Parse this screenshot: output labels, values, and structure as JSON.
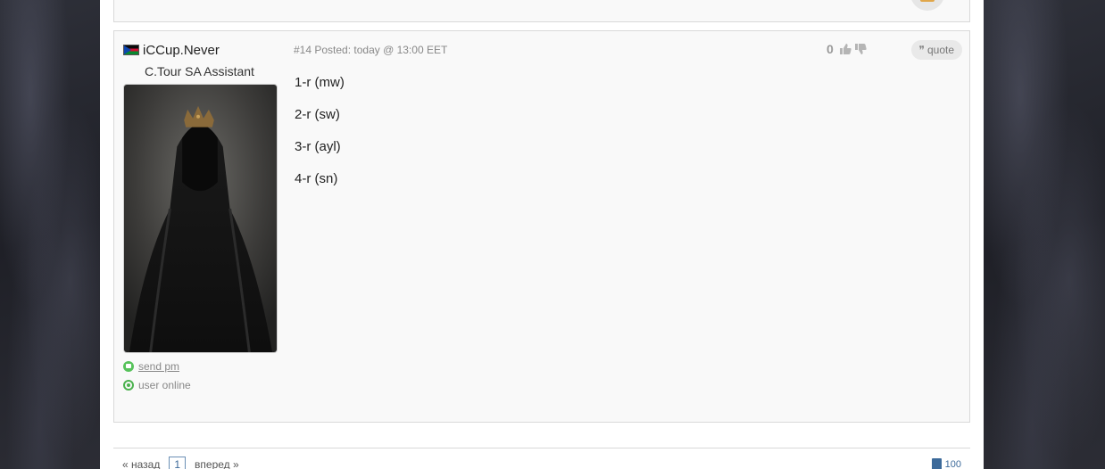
{
  "post": {
    "author": {
      "flag": "south-sudan-flag-icon",
      "name": "iCCup.Never",
      "title": "C.Tour SA Assistant",
      "avatar": "hooded-crowned-figure-avatar"
    },
    "links": {
      "send_pm": "send pm",
      "status": "user online"
    },
    "meta": "#14 Posted: today @ 13:00 EET",
    "rating": "0",
    "quote_label": "quote",
    "lines": [
      "1-r (mw)",
      "2-r (sw)",
      "3-r (ayl)",
      "4-r (sn)"
    ]
  },
  "pager": {
    "prev": "« назад",
    "current": "1",
    "next": "вперед »",
    "count": "100"
  },
  "colors": {
    "online": "#4cb24f",
    "link": "#3c6a9a",
    "post_bg": "#f9f9f9"
  }
}
